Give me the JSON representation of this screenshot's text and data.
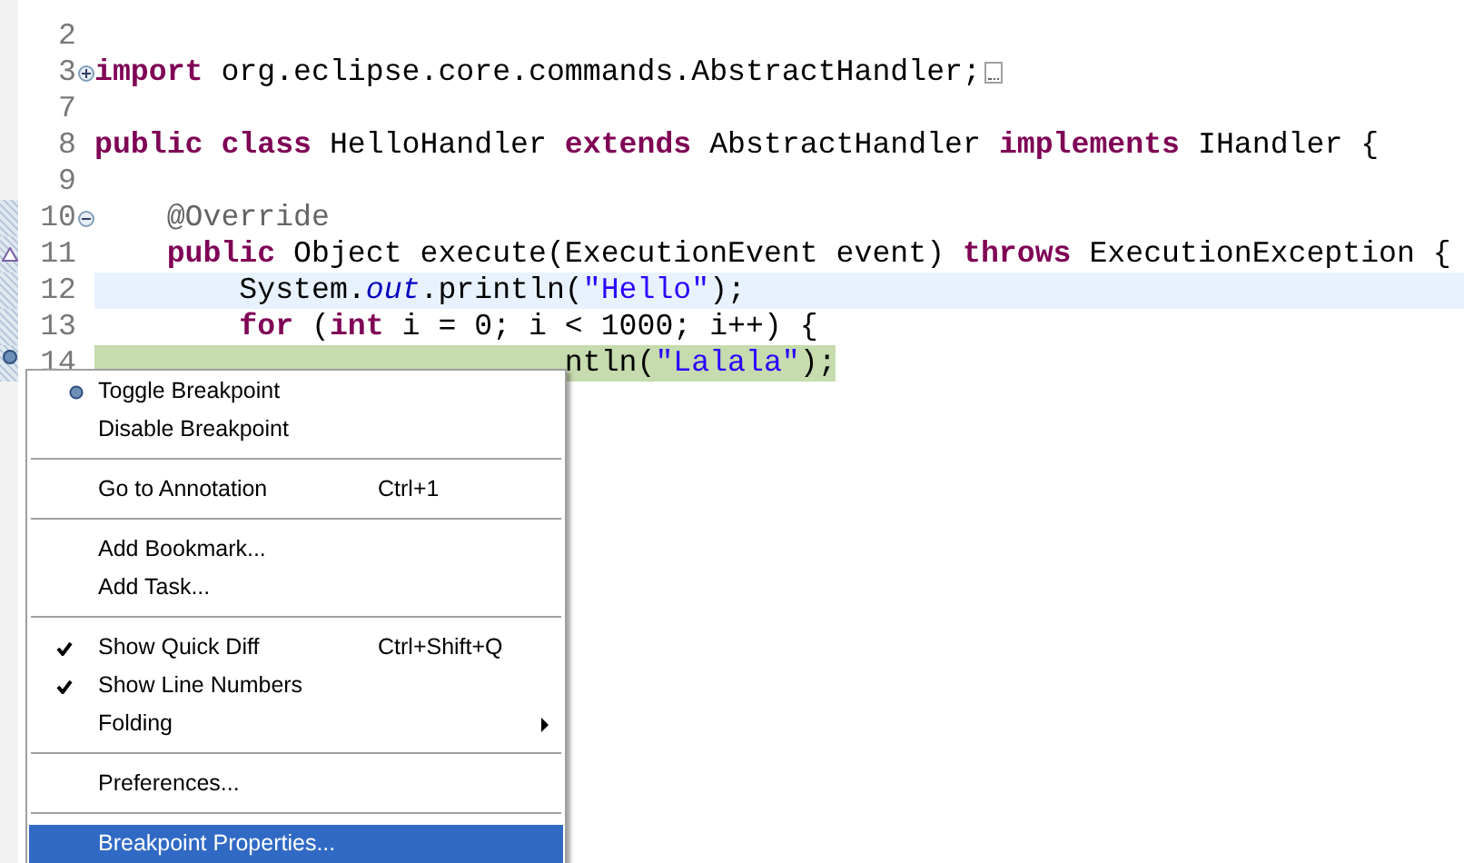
{
  "editor": {
    "lines": [
      {
        "number": "2",
        "changed": false
      },
      {
        "number": "3",
        "fold_control": true,
        "collapsed": true,
        "changed": false,
        "tokens": [
          {
            "kind": "keyword",
            "text": "import"
          },
          {
            "kind": "plain",
            "text": " org.eclipse.core.commands.AbstractHandler;"
          }
        ]
      },
      {
        "number": "7",
        "changed": false
      },
      {
        "number": "8",
        "changed": false,
        "tokens": [
          {
            "kind": "keyword",
            "text": "public class"
          },
          {
            "kind": "plain",
            "text": " HelloHandler "
          },
          {
            "kind": "keyword",
            "text": "extends"
          },
          {
            "kind": "plain",
            "text": " AbstractHandler "
          },
          {
            "kind": "keyword",
            "text": "implements"
          },
          {
            "kind": "plain",
            "text": " IHandler {"
          }
        ]
      },
      {
        "number": "9",
        "changed": false
      },
      {
        "number": "10",
        "fold_control": true,
        "collapsed": false,
        "changed": true,
        "tokens": [
          {
            "kind": "annotation",
            "text": "    @Override"
          }
        ]
      },
      {
        "number": "11",
        "override_marker": true,
        "changed": true,
        "tokens": [
          {
            "kind": "keyword",
            "text": "    public"
          },
          {
            "kind": "plain",
            "text": " Object execute(ExecutionEvent event) "
          },
          {
            "kind": "keyword",
            "text": "throws"
          },
          {
            "kind": "plain",
            "text": " ExecutionException {"
          }
        ]
      },
      {
        "number": "12",
        "current_line": true,
        "changed": true,
        "tokens": [
          {
            "kind": "plain",
            "text": "        System."
          },
          {
            "kind": "static",
            "text": "out"
          },
          {
            "kind": "plain",
            "text": ".println("
          },
          {
            "kind": "string",
            "text": "\"Hello\""
          },
          {
            "kind": "plain",
            "text": ");"
          }
        ]
      },
      {
        "number": "13",
        "changed": true,
        "tokens": [
          {
            "kind": "keyword",
            "text": "        for"
          },
          {
            "kind": "plain",
            "text": " ("
          },
          {
            "kind": "keyword",
            "text": "int"
          },
          {
            "kind": "plain",
            "text": " i = 0; i < 1000; i++) {"
          }
        ]
      },
      {
        "number": "14",
        "instruction_pointer": true,
        "breakpoint": true,
        "changed": true,
        "tokens": [
          {
            "kind": "plain",
            "text": "                          ntln("
          },
          {
            "kind": "string",
            "text": "\"Lalala\""
          },
          {
            "kind": "plain",
            "text": ");"
          }
        ]
      }
    ]
  },
  "context_menu": {
    "items": [
      {
        "kind": "item",
        "label": "Toggle Breakpoint",
        "has_icon": true,
        "checked": false,
        "selected": false
      },
      {
        "kind": "item",
        "label": "Disable Breakpoint",
        "checked": false,
        "selected": false
      },
      {
        "kind": "separator"
      },
      {
        "kind": "item",
        "label": "Go to Annotation",
        "shortcut": "Ctrl+1",
        "checked": false,
        "selected": false
      },
      {
        "kind": "separator"
      },
      {
        "kind": "item",
        "label": "Add Bookmark...",
        "checked": false,
        "selected": false
      },
      {
        "kind": "item",
        "label": "Add Task...",
        "checked": false,
        "selected": false
      },
      {
        "kind": "separator"
      },
      {
        "kind": "item",
        "label": "Show Quick Diff",
        "shortcut": "Ctrl+Shift+Q",
        "checked": true,
        "selected": false
      },
      {
        "kind": "item",
        "label": "Show Line Numbers",
        "checked": true,
        "selected": false
      },
      {
        "kind": "item",
        "label": "Folding",
        "submenu": true,
        "checked": false,
        "selected": false
      },
      {
        "kind": "separator"
      },
      {
        "kind": "item",
        "label": "Preferences...",
        "checked": false,
        "selected": false
      },
      {
        "kind": "separator"
      },
      {
        "kind": "item",
        "label": "Breakpoint Properties...",
        "checked": false,
        "selected": true
      }
    ]
  }
}
